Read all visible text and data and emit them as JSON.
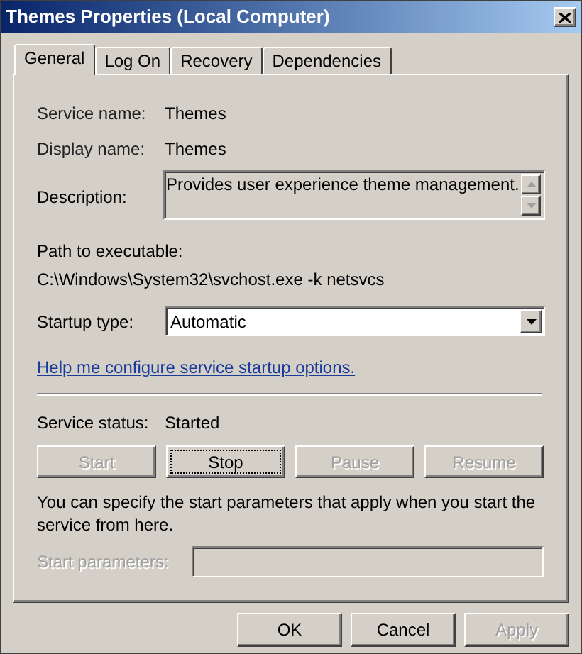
{
  "window": {
    "title": "Themes Properties (Local Computer)"
  },
  "tabs": [
    {
      "label": "General",
      "selected": true
    },
    {
      "label": "Log On",
      "selected": false
    },
    {
      "label": "Recovery",
      "selected": false
    },
    {
      "label": "Dependencies",
      "selected": false
    }
  ],
  "fields": [
    {
      "label": "Service name:",
      "value": "Themes"
    },
    {
      "label": "Display name:",
      "value": "Themes"
    }
  ],
  "description": {
    "label": "Description:",
    "value": "Provides user experience theme management."
  },
  "path": {
    "label": "Path to executable:",
    "value": "C:\\Windows\\System32\\svchost.exe -k netsvcs"
  },
  "startup_type": {
    "label": "Startup type:",
    "value": "Automatic"
  },
  "help_link": "Help me configure service startup options.",
  "service_status": {
    "label": "Service status:",
    "value": "Started"
  },
  "service_buttons": [
    {
      "label": "Start",
      "disabled": true,
      "focused": false
    },
    {
      "label": "Stop",
      "disabled": false,
      "focused": true
    },
    {
      "label": "Pause",
      "disabled": true,
      "focused": false
    },
    {
      "label": "Resume",
      "disabled": true,
      "focused": false
    }
  ],
  "note": "You can specify the start parameters that apply when you start the service from here.",
  "start_parameters": {
    "label": "Start parameters:",
    "disabled": true
  },
  "dialog_buttons": [
    {
      "label": "OK",
      "disabled": false
    },
    {
      "label": "Cancel",
      "disabled": false
    },
    {
      "label": "Apply",
      "disabled": true
    }
  ]
}
